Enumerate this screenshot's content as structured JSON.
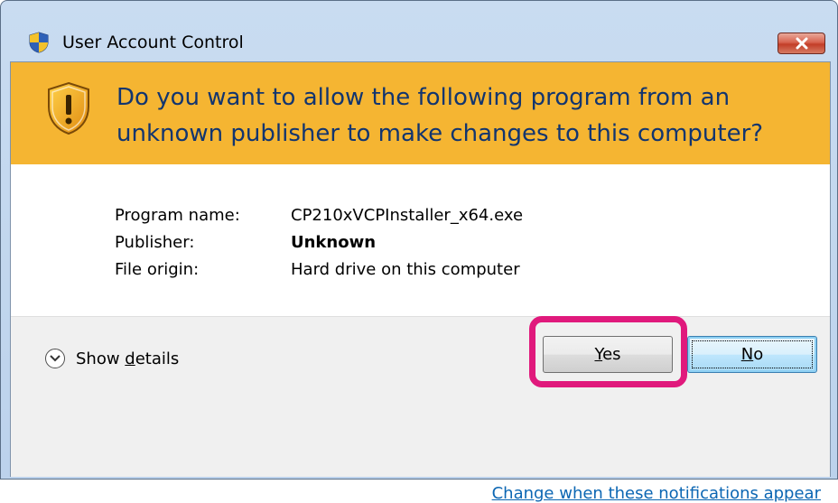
{
  "window": {
    "title": "User Account Control",
    "close_icon": "close-icon"
  },
  "banner": {
    "question": "Do you want to allow the following program from an unknown publisher to make changes to this computer?",
    "icon": "warning-shield-icon",
    "color": "#f5b532"
  },
  "details": {
    "program_label": "Program name:",
    "program_value": "CP210xVCPInstaller_x64.exe",
    "publisher_label": "Publisher:",
    "publisher_value": "Unknown",
    "origin_label": "File origin:",
    "origin_value": "Hard drive on this computer"
  },
  "footer": {
    "show_details_pre": "Show ",
    "show_details_mnemonic": "d",
    "show_details_post": "etails",
    "yes_mnemonic": "Y",
    "yes_rest": "es",
    "no_mnemonic": "N",
    "no_rest": "o",
    "link_text": "Change when these notifications appear",
    "highlight_color": "#e0197c"
  }
}
